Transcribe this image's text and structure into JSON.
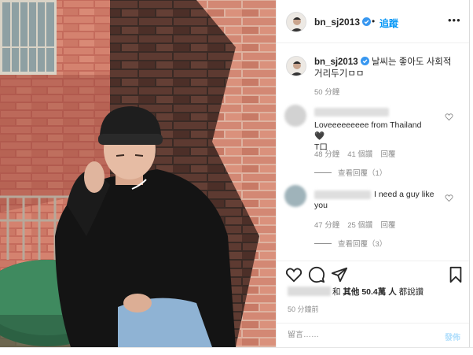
{
  "post": {
    "username": "bn_sj2013",
    "separator": "•",
    "follow_label": "追蹤",
    "more_label": "•••"
  },
  "caption": {
    "username": "bn_sj2013",
    "text": "날씨는 좋아도 사회적 거리두기ㅁㅁ",
    "time": "50 分鐘"
  },
  "comments": [
    {
      "text": "Loveeeeeeeee from Thailand",
      "line2": "T口",
      "time": "48 分鐘",
      "likes": "41 個讚",
      "reply": "回覆",
      "view_replies": "查看回覆（1）"
    },
    {
      "text": "I need a guy like you",
      "time": "47 分鐘",
      "likes": "25 個讚",
      "reply": "回覆",
      "view_replies": "查看回覆（3）"
    }
  ],
  "likes": {
    "prefix": "和",
    "others_label": "其他 50.4萬 人",
    "suffix": "都說讚"
  },
  "post_time": "50 分鐘前",
  "comment_box": {
    "placeholder": "留言……",
    "post_label": "發佈"
  },
  "icons": {
    "heart": "heart-icon",
    "comment": "comment-icon",
    "share": "share-icon",
    "bookmark": "bookmark-icon",
    "verified": "verified-badge-icon"
  },
  "colors": {
    "link_blue": "#0095f6",
    "muted_grey": "#8e8e8e",
    "post_disabled": "#b2dffc"
  }
}
